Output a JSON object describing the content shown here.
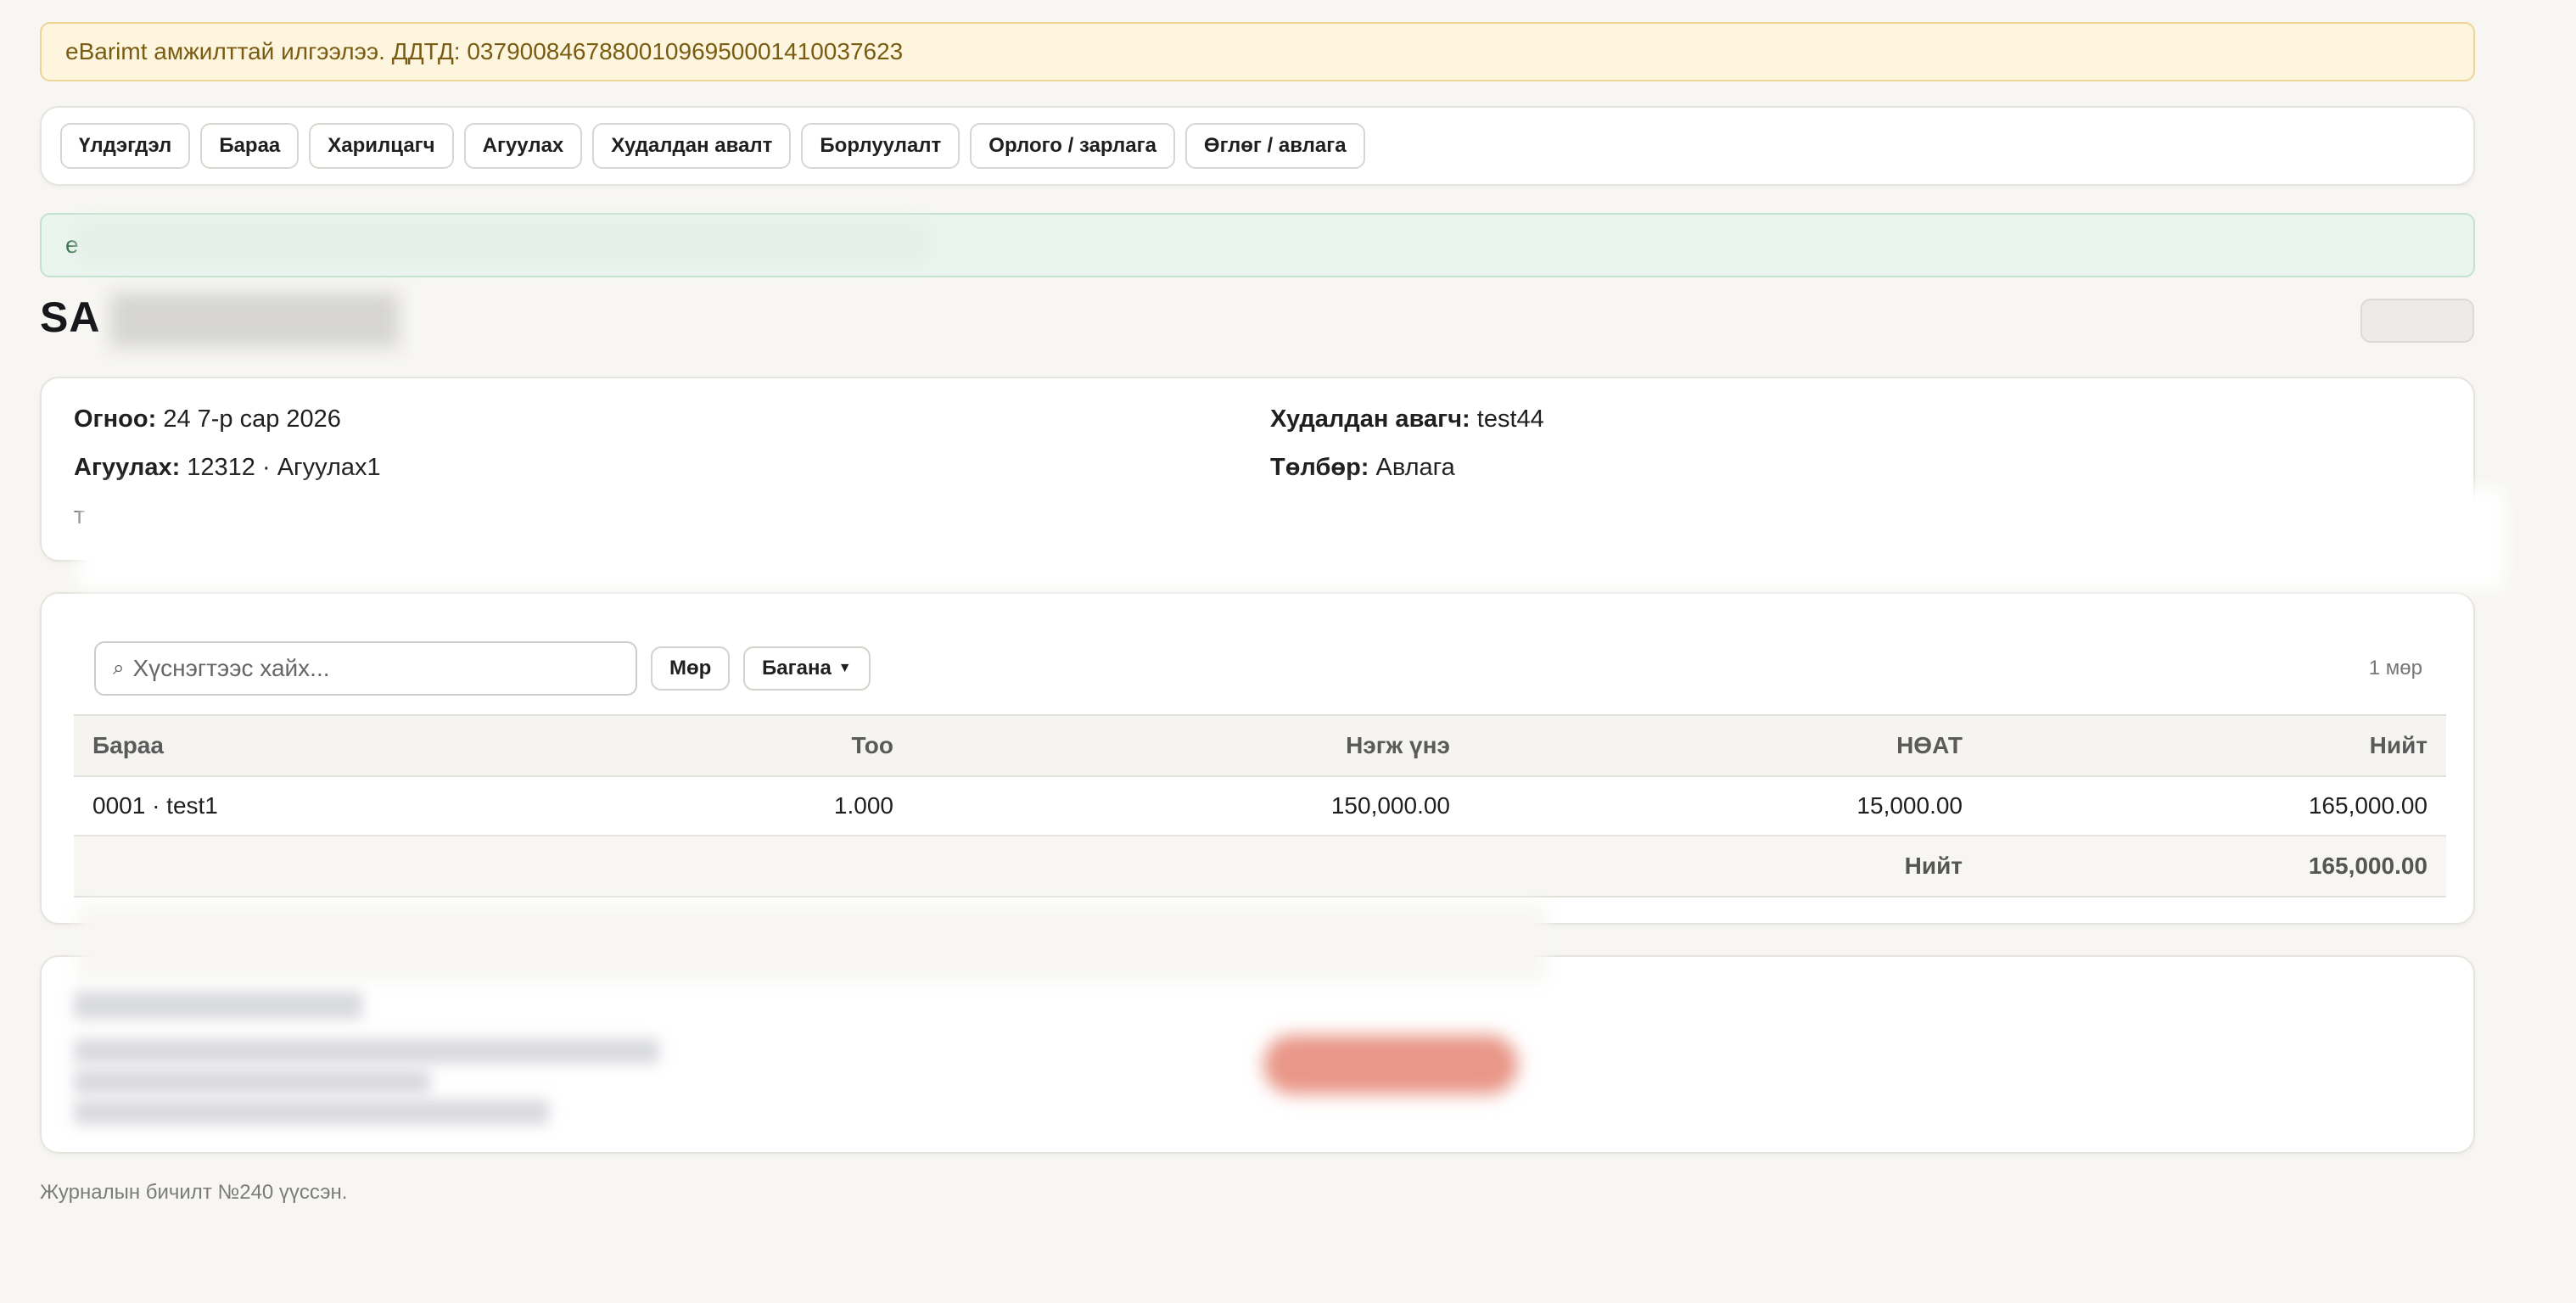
{
  "alerts": {
    "warning": "eBarimt амжилттай илгээлээ. ДДТД: 037900846788001096950001410037623",
    "success": "e"
  },
  "nav": {
    "items": [
      {
        "label": "Үлдэгдэл"
      },
      {
        "label": "Бараа"
      },
      {
        "label": "Харилцагч"
      },
      {
        "label": "Агуулах"
      },
      {
        "label": "Худалдан авалт"
      },
      {
        "label": "Борлуулалт"
      },
      {
        "label": "Орлого / зарлага"
      },
      {
        "label": "Өглөг / авлага"
      }
    ]
  },
  "page": {
    "title": "SA"
  },
  "info": {
    "date_label": "Огноо:",
    "date_value": "24 7-р сар 2026",
    "buyer_label": "Худалдан авагч:",
    "buyer_value": "test44",
    "warehouse_label": "Агуулах:",
    "warehouse_value": "12312 · Агуулах1",
    "payment_label": "Төлбөр:",
    "payment_value": "Авлага",
    "partial": "т"
  },
  "table": {
    "search_placeholder": "Хүснэгтээс хайх...",
    "row_button": "Мөр",
    "column_button": "Багана",
    "row_count": "1 мөр",
    "headers": [
      "Бараа",
      "Тоо",
      "Нэгж үнэ",
      "НӨАТ",
      "Нийт"
    ],
    "rows": [
      [
        "0001 · test1",
        "1.000",
        "150,000.00",
        "15,000.00",
        "165,000.00"
      ]
    ],
    "total_label": "Нийт",
    "total_value": "165,000.00"
  },
  "footer": {
    "text": "Журналын бичилт №240 үүссэн."
  },
  "colors": {
    "warning_bg": "#fdf5dd",
    "success_bg": "#e9f5ee",
    "accent_red": "#e99788"
  }
}
